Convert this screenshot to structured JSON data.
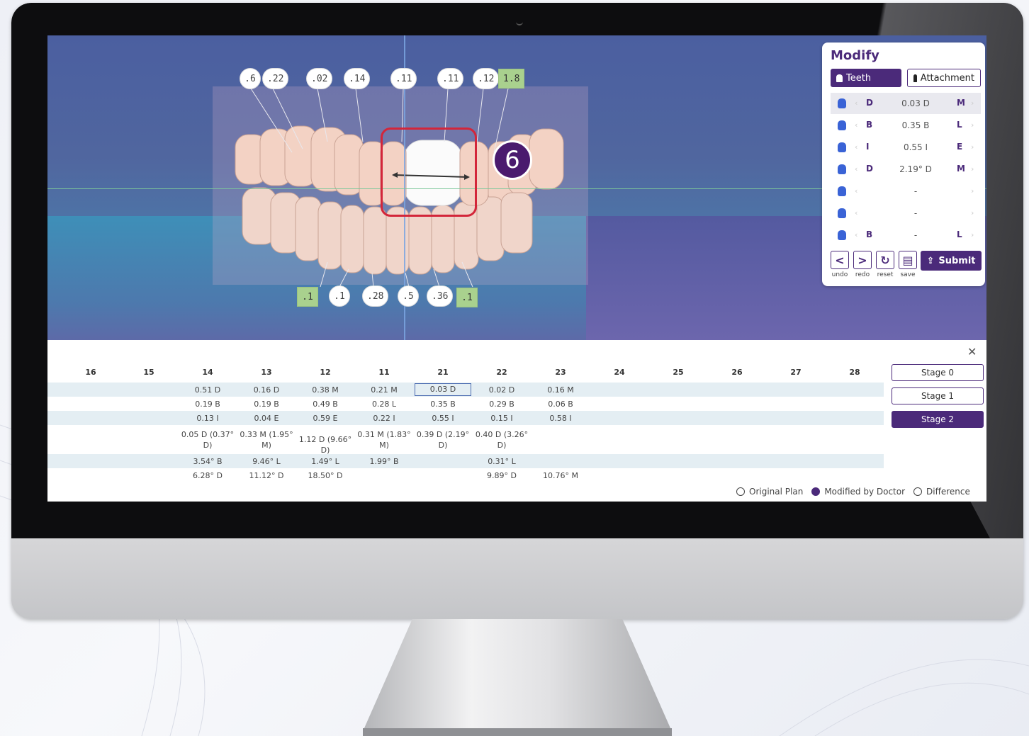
{
  "viewport": {
    "top_chips": [
      ".6",
      ".22",
      ".02",
      ".14",
      ".11",
      ".11",
      ".12",
      "1.8"
    ],
    "bottom_chips": [
      ".1",
      ".1",
      ".28",
      ".5",
      ".36",
      ".1"
    ],
    "step_badge": "6"
  },
  "modify": {
    "title": "Modify",
    "tabs": {
      "teeth": "Teeth",
      "attachment": "Attachment"
    },
    "rows": [
      {
        "left": "D",
        "value": "0.03 D",
        "right": "M"
      },
      {
        "left": "B",
        "value": "0.35 B",
        "right": "L"
      },
      {
        "left": "I",
        "value": "0.55 I",
        "right": "E"
      },
      {
        "left": "D",
        "value": "2.19° D",
        "right": "M"
      },
      {
        "left": "",
        "value": "-",
        "right": ""
      },
      {
        "left": "",
        "value": "-",
        "right": ""
      },
      {
        "left": "B",
        "value": "-",
        "right": "L"
      }
    ],
    "controls": {
      "undo": "undo",
      "redo": "redo",
      "reset": "reset",
      "save": "save",
      "submit": "Submit"
    }
  },
  "table": {
    "close": "✕",
    "headers": [
      "16",
      "15",
      "14",
      "13",
      "12",
      "11",
      "21",
      "22",
      "23",
      "24",
      "25",
      "26",
      "27",
      "28"
    ],
    "rows": [
      [
        "",
        "",
        "0.51 D",
        "0.16 D",
        "0.38 M",
        "0.21 M",
        "0.03 D",
        "0.02 D",
        "0.16 M",
        "",
        "",
        "",
        "",
        ""
      ],
      [
        "",
        "",
        "0.19 B",
        "0.19 B",
        "0.49 B",
        "0.28 L",
        "0.35 B",
        "0.29 B",
        "0.06 B",
        "",
        "",
        "",
        "",
        ""
      ],
      [
        "",
        "",
        "0.13 I",
        "0.04 E",
        "0.59 E",
        "0.22 I",
        "0.55 I",
        "0.15 I",
        "0.58 I",
        "",
        "",
        "",
        "",
        ""
      ],
      [
        "",
        "",
        "0.05 D (0.37° D)",
        "0.33 M (1.95° M)",
        "1.12 D (9.66° D)",
        "0.31 M (1.83° M)",
        "0.39 D (2.19° D)",
        "0.40 D (3.26° D)",
        "",
        "",
        "",
        "",
        "",
        ""
      ],
      [
        "",
        "",
        "3.54° B",
        "9.46° L",
        "1.49° L",
        "1.99° B",
        "",
        "0.31° L",
        "",
        "",
        "",
        "",
        "",
        ""
      ],
      [
        "",
        "",
        "6.28° D",
        "11.12° D",
        "18.50° D",
        "",
        "",
        "9.89° D",
        "10.76° M",
        "",
        "",
        "",
        "",
        ""
      ]
    ],
    "stages": [
      "Stage 0",
      "Stage 1",
      "Stage 2"
    ],
    "legend": [
      "Original Plan",
      "Modified by Doctor",
      "Difference"
    ]
  },
  "colors": {
    "accent": "#4b2a7a",
    "highlight": "#d3263a",
    "chip_green": "#a9d18e"
  }
}
